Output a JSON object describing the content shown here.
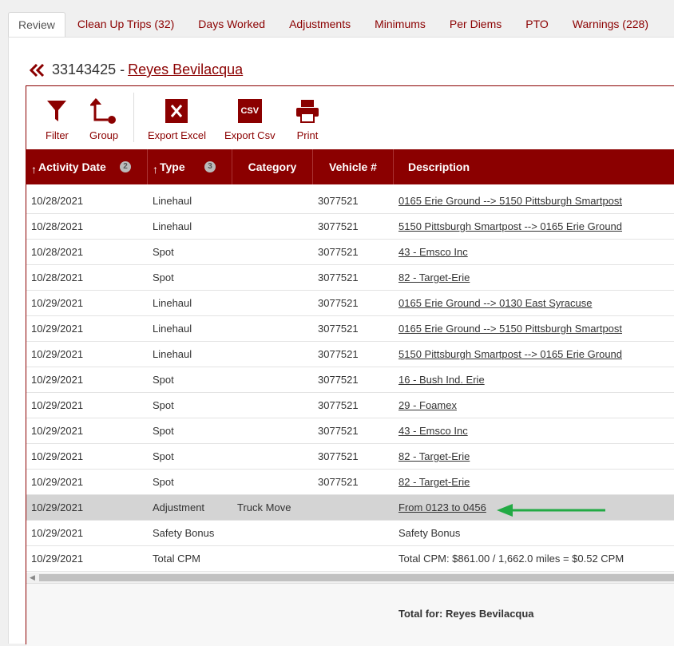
{
  "tabs": [
    {
      "label": "Review"
    },
    {
      "label": "Clean Up Trips (32)"
    },
    {
      "label": "Days Worked"
    },
    {
      "label": "Adjustments"
    },
    {
      "label": "Minimums"
    },
    {
      "label": "Per Diems"
    },
    {
      "label": "PTO"
    },
    {
      "label": "Warnings (228)"
    }
  ],
  "header": {
    "id": "33143425 -",
    "name": "Reyes Bevilacqua"
  },
  "toolbar": {
    "filter": "Filter",
    "group": "Group",
    "export_excel": "Export Excel",
    "export_csv": "Export Csv",
    "csv_icon_text": "CSV",
    "print": "Print"
  },
  "columns": {
    "activity_date": "Activity Date",
    "activity_date_sort": "2",
    "type": "Type",
    "type_sort": "3",
    "category": "Category",
    "vehicle": "Vehicle #",
    "description": "Description"
  },
  "rows": [
    {
      "date": "10/28/2021",
      "type": "Linehaul",
      "category": "",
      "vehicle": "3077521",
      "description": "0165 Erie Ground --> 5150 Pittsburgh Smartpost",
      "link": true
    },
    {
      "date": "10/28/2021",
      "type": "Linehaul",
      "category": "",
      "vehicle": "3077521",
      "description": "5150 Pittsburgh Smartpost --> 0165 Erie Ground",
      "link": true
    },
    {
      "date": "10/28/2021",
      "type": "Spot",
      "category": "",
      "vehicle": "3077521",
      "description": "43 - Emsco Inc",
      "link": true
    },
    {
      "date": "10/28/2021",
      "type": "Spot",
      "category": "",
      "vehicle": "3077521",
      "description": "82 - Target-Erie",
      "link": true
    },
    {
      "date": "10/29/2021",
      "type": "Linehaul",
      "category": "",
      "vehicle": "3077521",
      "description": "0165 Erie Ground --> 0130 East Syracuse",
      "link": true
    },
    {
      "date": "10/29/2021",
      "type": "Linehaul",
      "category": "",
      "vehicle": "3077521",
      "description": "0165 Erie Ground --> 5150 Pittsburgh Smartpost",
      "link": true
    },
    {
      "date": "10/29/2021",
      "type": "Linehaul",
      "category": "",
      "vehicle": "3077521",
      "description": "5150 Pittsburgh Smartpost --> 0165 Erie Ground",
      "link": true
    },
    {
      "date": "10/29/2021",
      "type": "Spot",
      "category": "",
      "vehicle": "3077521",
      "description": "16 - Bush Ind. Erie",
      "link": true
    },
    {
      "date": "10/29/2021",
      "type": "Spot",
      "category": "",
      "vehicle": "3077521",
      "description": "29 - Foamex",
      "link": true
    },
    {
      "date": "10/29/2021",
      "type": "Spot",
      "category": "",
      "vehicle": "3077521",
      "description": "43 - Emsco Inc",
      "link": true
    },
    {
      "date": "10/29/2021",
      "type": "Spot",
      "category": "",
      "vehicle": "3077521",
      "description": "82 - Target-Erie",
      "link": true
    },
    {
      "date": "10/29/2021",
      "type": "Spot",
      "category": "",
      "vehicle": "3077521",
      "description": "82 - Target-Erie",
      "link": true
    },
    {
      "date": "10/29/2021",
      "type": "Adjustment",
      "category": "Truck Move",
      "vehicle": "",
      "description": "From 0123 to 0456",
      "link": true,
      "highlight": true
    },
    {
      "date": "10/29/2021",
      "type": "Safety Bonus",
      "category": "",
      "vehicle": "",
      "description": "Safety Bonus",
      "link": false
    },
    {
      "date": "10/29/2021",
      "type": "Total CPM",
      "category": "",
      "vehicle": "",
      "description": "Total CPM: $861.00 / 1,662.0 miles = $0.52 CPM",
      "link": false
    }
  ],
  "footer": {
    "total_label": "Total for: Reyes Bevilacqua"
  },
  "colors": {
    "brand": "#8b0000",
    "annotation_arrow": "#22aa44",
    "highlight_row": "#d4d4d4"
  }
}
